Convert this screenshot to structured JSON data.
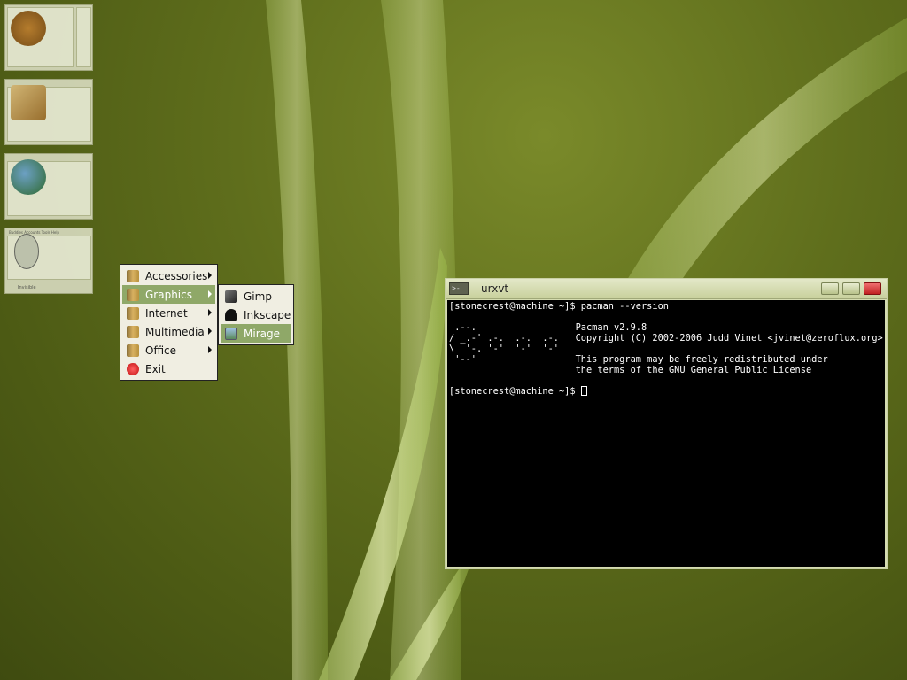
{
  "thumbnails": [
    {
      "name": "window-thumbnail-1",
      "icon": "people-icon"
    },
    {
      "name": "window-thumbnail-2",
      "icon": "pencil-icon"
    },
    {
      "name": "window-thumbnail-3",
      "icon": "globe-icon"
    },
    {
      "name": "window-thumbnail-4",
      "icon": "buddy-icon",
      "menu": "Buddies  Accounts  Tools  Help",
      "status": "Invisible"
    }
  ],
  "menu": {
    "items": [
      {
        "label": "Accessories",
        "submenu": true
      },
      {
        "label": "Graphics",
        "submenu": true,
        "selected": true
      },
      {
        "label": "Internet",
        "submenu": true
      },
      {
        "label": "Multimedia",
        "submenu": true
      },
      {
        "label": "Office",
        "submenu": true
      },
      {
        "label": "Exit",
        "submenu": false
      }
    ],
    "graphics_submenu": [
      {
        "label": "Gimp"
      },
      {
        "label": "Inkscape"
      },
      {
        "label": "Mirage",
        "selected": true
      }
    ]
  },
  "terminal": {
    "title": "urxvt",
    "icon_text": ">-",
    "lines": [
      "[stonecrest@machine ~]$ pacman --version",
      "",
      " .--.                  Pacman v2.9.8",
      "/ _.-' .-.  .-.  .-.   Copyright (C) 2002-2006 Judd Vinet <jvinet@zeroflux.org>",
      "\\  '-. '-'  '-'  '-'",
      " '--'                  This program may be freely redistributed under",
      "                       the terms of the GNU General Public License",
      ""
    ],
    "prompt": "[stonecrest@machine ~]$ "
  },
  "colors": {
    "menu_selected": "#8fa868",
    "terminal_bg": "#000000",
    "desktop": "#5f6e1c"
  }
}
